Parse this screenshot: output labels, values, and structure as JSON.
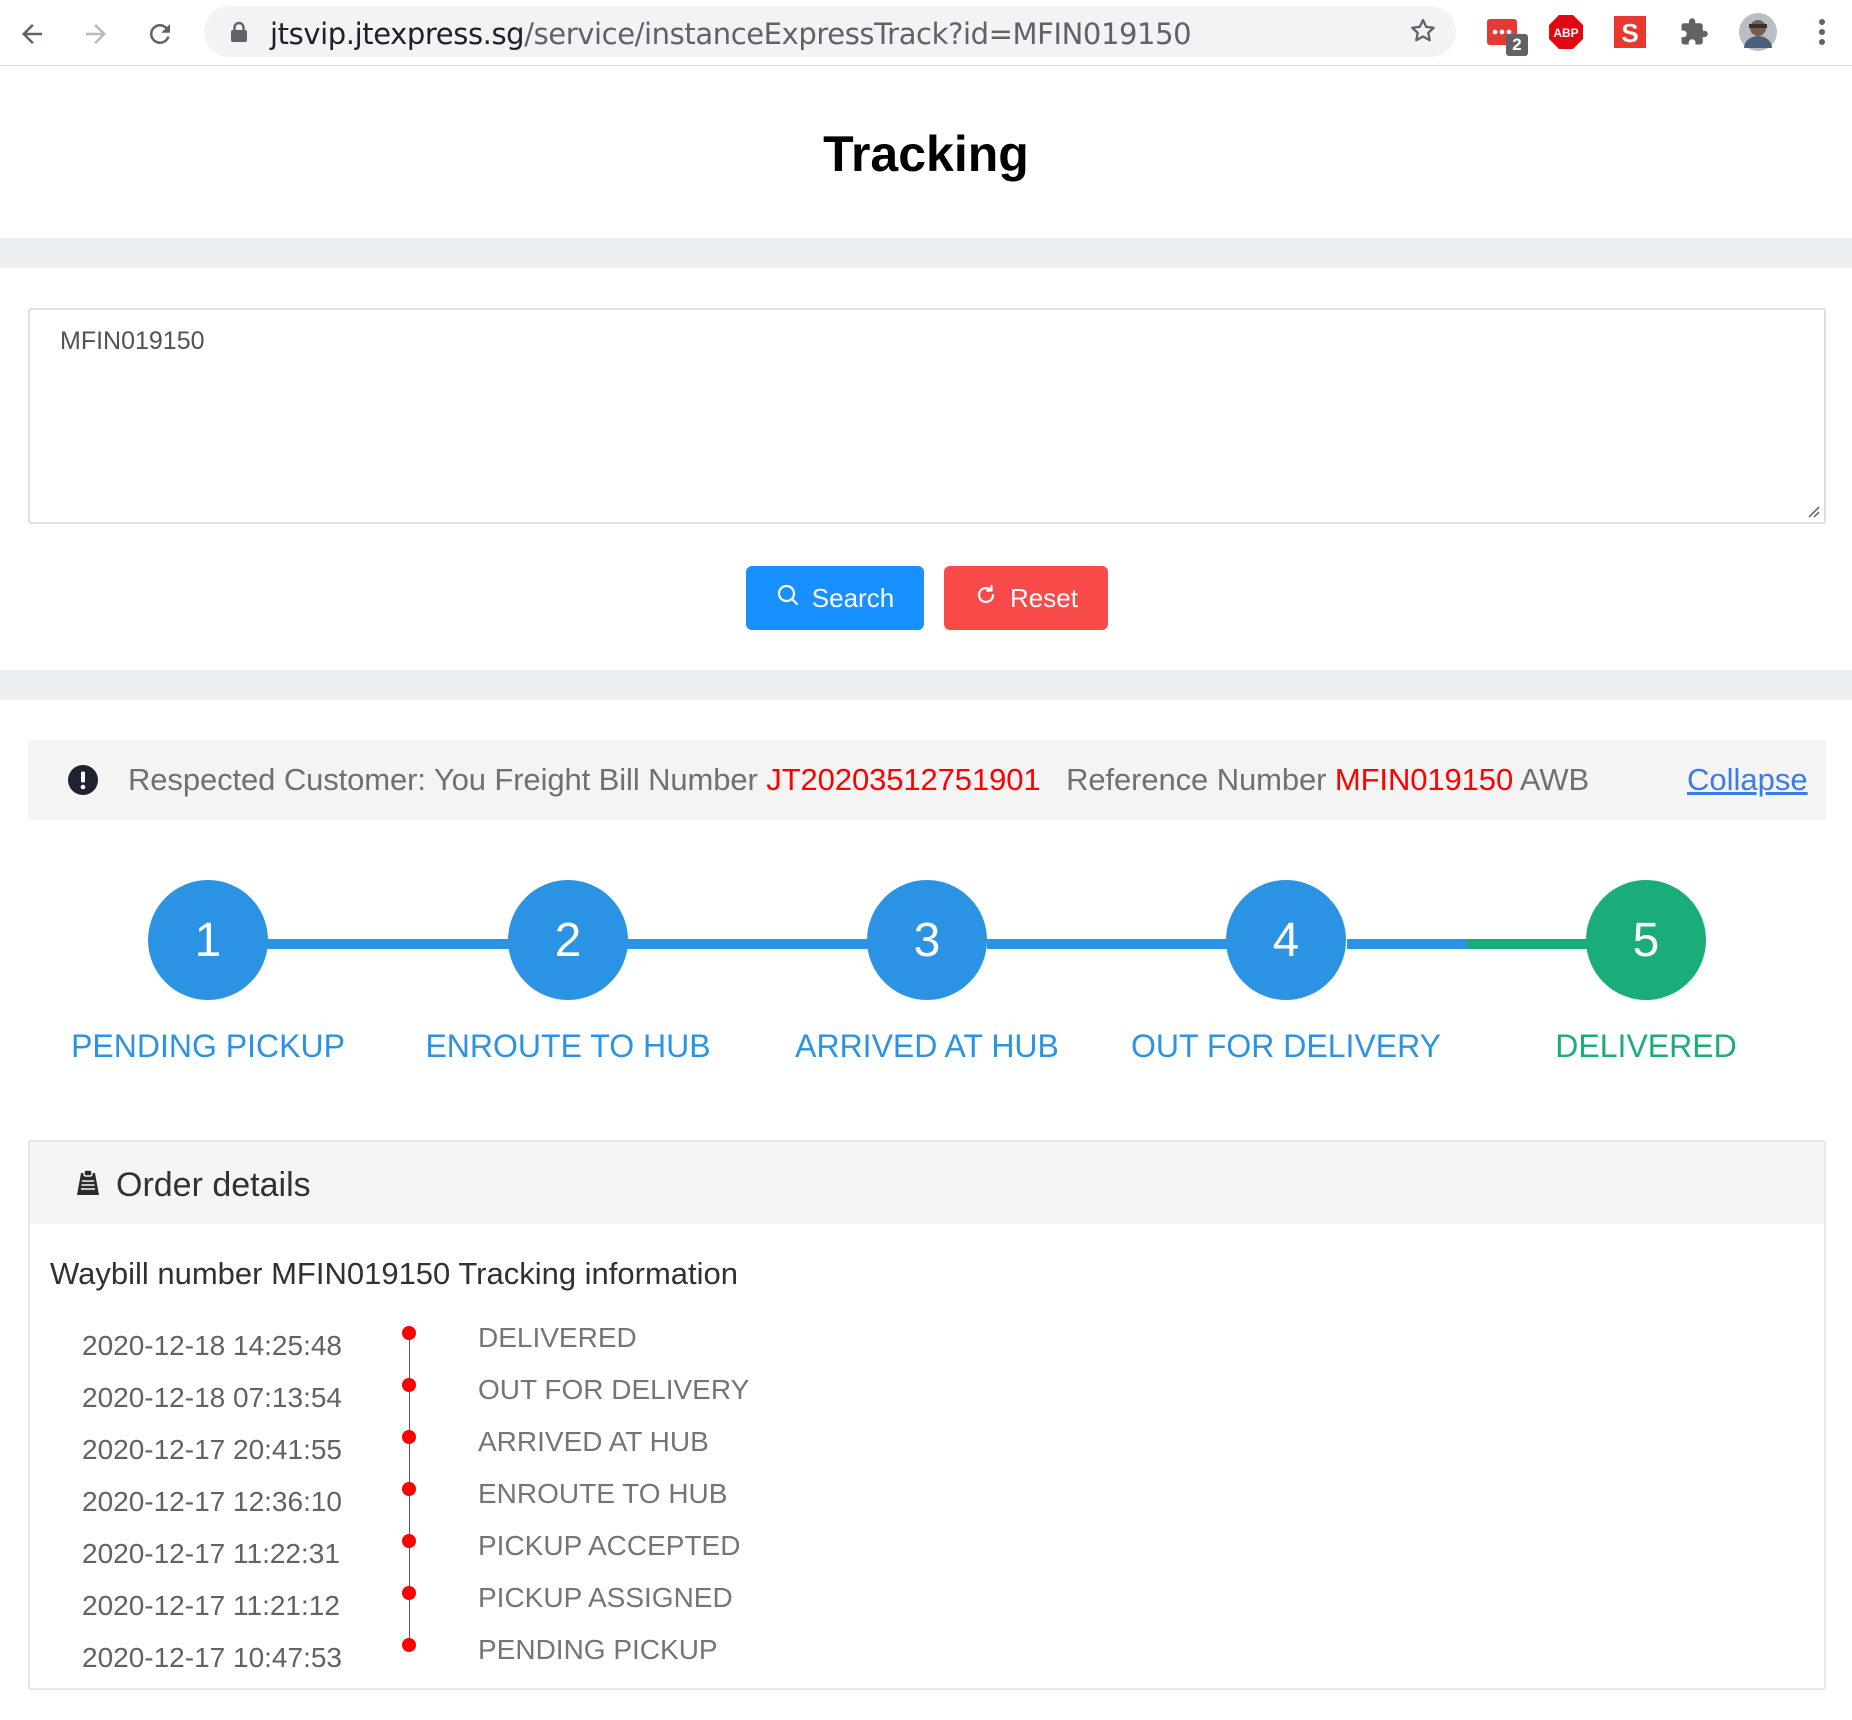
{
  "browser": {
    "url_domain": "jtsvip.jtexpress.sg",
    "url_path": "/service/instanceExpressTrack?id=MFIN019150",
    "extension_badge": "2",
    "extensions": [
      "todo-extension-icon",
      "adblock-plus-icon",
      "s-extension-icon",
      "puzzle-icon",
      "avatar"
    ]
  },
  "page": {
    "title": "Tracking"
  },
  "search": {
    "value": "MFIN019150",
    "search_label": "Search",
    "reset_label": "Reset"
  },
  "notice": {
    "prefix": "Respected Customer: You Freight Bill Number ",
    "bill_number": "JT20203512751901",
    "middle": "Reference Number ",
    "reference_number": "MFIN019150",
    "suffix": " AWB",
    "collapse_label": "Collapse"
  },
  "steps": [
    {
      "number": "1",
      "label": "PENDING PICKUP"
    },
    {
      "number": "2",
      "label": "ENROUTE TO HUB"
    },
    {
      "number": "3",
      "label": "ARRIVED AT HUB"
    },
    {
      "number": "4",
      "label": "OUT FOR DELIVERY"
    },
    {
      "number": "5",
      "label": "DELIVERED"
    }
  ],
  "current_step": 5,
  "colors": {
    "step_active": "#2b93e3",
    "step_done": "#1aad7a",
    "search_button": "#1890ff",
    "reset_button": "#f94a4a",
    "highlight_red": "#ff0000"
  },
  "order_details": {
    "title": "Order details",
    "waybill_heading": "Waybill number MFIN019150 Tracking information",
    "events": [
      {
        "time": "2020-12-18 14:25:48",
        "status": "DELIVERED"
      },
      {
        "time": "2020-12-18 07:13:54",
        "status": "OUT FOR DELIVERY"
      },
      {
        "time": "2020-12-17 20:41:55",
        "status": "ARRIVED AT HUB"
      },
      {
        "time": "2020-12-17 12:36:10",
        "status": "ENROUTE TO HUB"
      },
      {
        "time": "2020-12-17 11:22:31",
        "status": "PICKUP ACCEPTED"
      },
      {
        "time": "2020-12-17 11:21:12",
        "status": "PICKUP ASSIGNED"
      },
      {
        "time": "2020-12-17 10:47:53",
        "status": "PENDING PICKUP"
      }
    ]
  }
}
